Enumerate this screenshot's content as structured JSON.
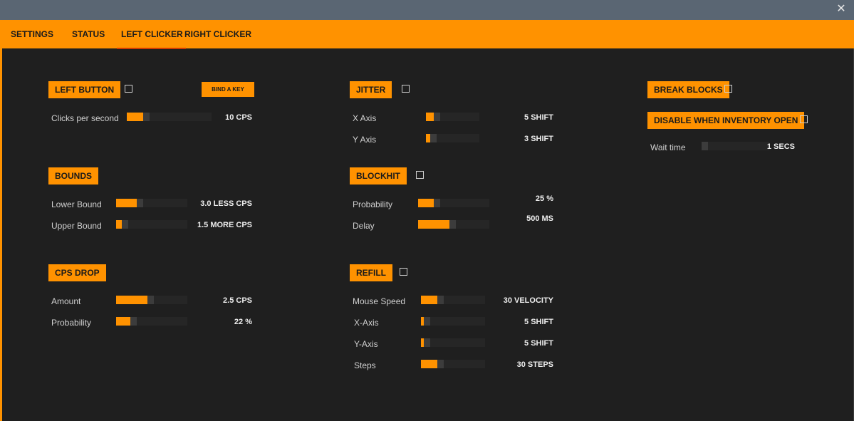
{
  "window": {
    "close_glyph": "✕"
  },
  "tabs": [
    {
      "label": "SETTINGS"
    },
    {
      "label": "STATUS"
    },
    {
      "label": "LEFT CLICKER"
    },
    {
      "label": "RIGHT CLICKER"
    }
  ],
  "active_tab": "LEFT CLICKER",
  "colors": {
    "accent": "#ff9200",
    "background": "#1f1f1f",
    "titlebar": "#5a6673",
    "track": "#262626",
    "knob": "#3c3c3c"
  },
  "left_button": {
    "heading": "LEFT BUTTON",
    "enabled": false,
    "bind_button": "BIND A KEY",
    "rows": [
      {
        "label": "Clicks per second",
        "value": "10 CPS",
        "fill": 0.19
      }
    ]
  },
  "bounds": {
    "heading": "BOUNDS",
    "rows": [
      {
        "label": "Lower Bound",
        "value": "3.0 LESS CPS",
        "fill": 0.29
      },
      {
        "label": "Upper Bound",
        "value": "1.5 MORE CPS",
        "fill": 0.08
      }
    ]
  },
  "cps_drop": {
    "heading": "CPS DROP",
    "rows": [
      {
        "label": "Amount",
        "value": "2.5 CPS",
        "fill": 0.44
      },
      {
        "label": "Probability",
        "value": "22 %",
        "fill": 0.2
      }
    ]
  },
  "jitter": {
    "heading": "JITTER",
    "enabled": false,
    "rows": [
      {
        "label": "X Axis",
        "value": "5 SHIFT",
        "fill": 0.15
      },
      {
        "label": "Y Axis",
        "value": "3 SHIFT",
        "fill": 0.08
      }
    ]
  },
  "blockhit": {
    "heading": "BLOCKHIT",
    "enabled": false,
    "rows": [
      {
        "label": "Probability",
        "value": "25 %",
        "fill": 0.22
      },
      {
        "label": "Delay",
        "value": "500 MS",
        "fill": 0.44
      }
    ]
  },
  "refill": {
    "heading": "REFILL",
    "enabled": false,
    "rows": [
      {
        "label": "Mouse Speed",
        "value": "30 VELOCITY",
        "fill": 0.25
      },
      {
        "label": "X-Axis",
        "value": "5 SHIFT",
        "fill": 0.04
      },
      {
        "label": "Y-Axis",
        "value": "5 SHIFT",
        "fill": 0.04
      },
      {
        "label": "Steps",
        "value": "30 STEPS",
        "fill": 0.25
      }
    ]
  },
  "break_blocks": {
    "heading": "BREAK BLOCKS",
    "enabled": false
  },
  "disable_inventory": {
    "heading": "DISABLE WHEN INVENTORY OPEN",
    "enabled": false,
    "rows": [
      {
        "label": "Wait time",
        "value": "1 SECS",
        "fill": 0.0
      }
    ]
  }
}
